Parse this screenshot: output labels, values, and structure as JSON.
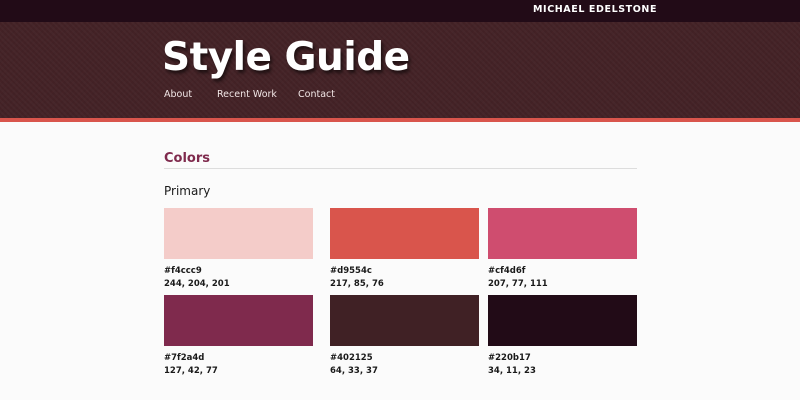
{
  "topbar": {
    "author": "MICHAEL EDELSTONE"
  },
  "header": {
    "title": "Style Guide",
    "nav": [
      "About",
      "Recent Work",
      "Contact"
    ]
  },
  "main": {
    "section_title": "Colors",
    "sub_title": "Primary",
    "swatches": [
      {
        "hex": "#f4ccc9",
        "rgb": "244, 204, 201",
        "color": "#f4ccc9"
      },
      {
        "hex": "#d9554c",
        "rgb": "217, 85, 76",
        "color": "#d9554c"
      },
      {
        "hex": "#cf4d6f",
        "rgb": "207, 77, 111",
        "color": "#cf4d6f"
      },
      {
        "hex": "#7f2a4d",
        "rgb": "127, 42, 77",
        "color": "#7f2a4d"
      },
      {
        "hex": "#402125",
        "rgb": "64, 33, 37",
        "color": "#402125"
      },
      {
        "hex": "#220b17",
        "rgb": "34, 11, 23",
        "color": "#220b17"
      }
    ]
  }
}
